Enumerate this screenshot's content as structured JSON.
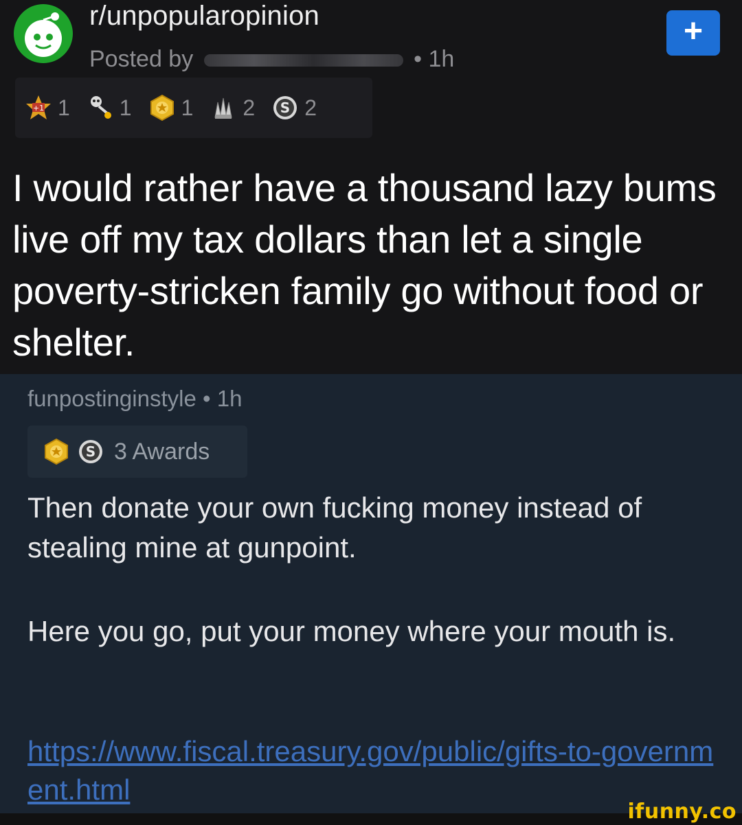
{
  "post": {
    "subreddit": "r/unpopularopinion",
    "posted_by_prefix": "Posted by",
    "age": "• 1h",
    "join_button": "+",
    "awards": [
      {
        "icon": "plus-one-award-icon",
        "count": "1"
      },
      {
        "icon": "skeleton-award-icon",
        "count": "1"
      },
      {
        "icon": "gold-award-icon",
        "count": "1"
      },
      {
        "icon": "wholesome-award-icon",
        "count": "2"
      },
      {
        "icon": "silver-award-icon",
        "count": "2"
      }
    ],
    "title": "I would rather have a thousand lazy bums live off my tax dollars than let a single poverty-stricken family go without food or shelter."
  },
  "comment": {
    "author": "funpostinginstyle",
    "age": "• 1h",
    "awards_label": "3 Awards",
    "paragraph_1": "Then donate your own fucking money instead of stealing mine at gunpoint.",
    "paragraph_2": "Here you go, put your money where your mouth is.",
    "link": "https://www.fiscal.treasury.gov/public/gifts-to-government.html"
  },
  "watermark": "ifunny.co",
  "colors": {
    "post_bg": "#151517",
    "comment_bg": "#1a2430",
    "join_button": "#1d6fd6",
    "link": "#3d6fbd",
    "watermark": "#f2c200"
  }
}
